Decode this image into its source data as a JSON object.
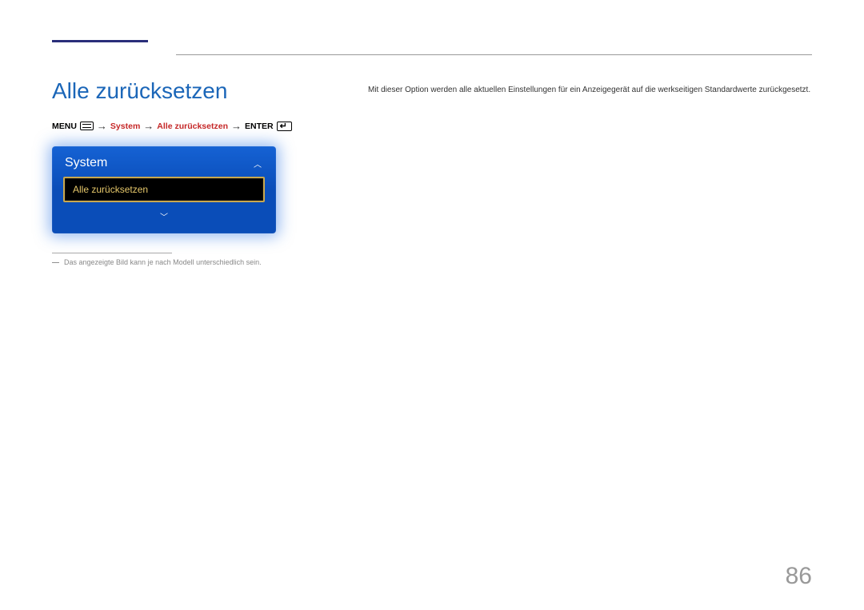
{
  "heading": "Alle zurücksetzen",
  "description": "Mit dieser Option werden alle aktuellen Einstellungen für ein Anzeigegerät auf die werkseitigen Standardwerte zurückgesetzt.",
  "breadcrumb": {
    "menu": "MENU",
    "step1": "System",
    "step2": "Alle zurücksetzen",
    "enter": "ENTER",
    "arrow": "→"
  },
  "tv_menu": {
    "title": "System",
    "selected_item": "Alle zurücksetzen",
    "chevron_up": "︿",
    "chevron_down": "﹀"
  },
  "footnote_marker": "―",
  "footnote": "Das angezeigte Bild kann je nach Modell unterschiedlich sein.",
  "page_number": "86"
}
